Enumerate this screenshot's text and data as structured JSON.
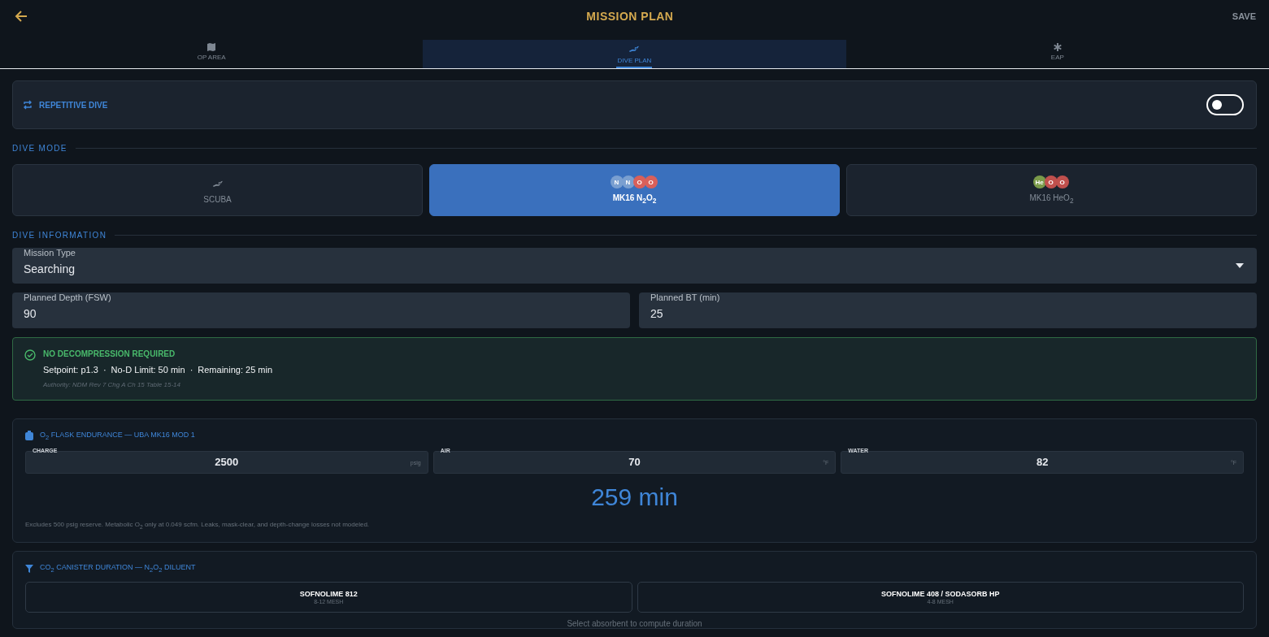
{
  "header": {
    "title": "MISSION PLAN",
    "action": "SAVE"
  },
  "tabs": [
    {
      "label": "OP AREA",
      "kind": "map",
      "selected": false
    },
    {
      "label": "DIVE PLAN",
      "kind": "diver",
      "selected": true
    },
    {
      "label": "EAP",
      "kind": "asterisk",
      "selected": false
    }
  ],
  "repetitive_dive": {
    "label": "REPETITIVE DIVE",
    "on": false
  },
  "dive_mode": {
    "heading": "DIVE MODE",
    "modes": [
      {
        "label": "SCUBA",
        "kind": "diver",
        "selected": false
      },
      {
        "label": "MK16 N$_{2}$O$_{2}$",
        "kind": "gas",
        "selected": true,
        "atoms": [
          {
            "symbol": "N",
            "color": "#7a9fd0"
          },
          {
            "symbol": "N",
            "color": "#7a9fd0"
          },
          {
            "symbol": "O",
            "color": "#d9605a"
          },
          {
            "symbol": "O",
            "color": "#d9605a"
          }
        ]
      },
      {
        "label": "MK16 HeO$_{2}$",
        "kind": "gas",
        "selected": false,
        "atoms": [
          {
            "symbol": "He",
            "color": "#7a9a4a"
          },
          {
            "symbol": "O",
            "color": "#c0504d"
          },
          {
            "symbol": "O",
            "color": "#c0504d"
          }
        ]
      }
    ]
  },
  "dive_information": {
    "heading": "DIVE INFORMATION",
    "mission_type": {
      "label": "Mission Type",
      "value": "Searching"
    },
    "planned_depth": {
      "label": "Planned Depth (FSW)",
      "value": "90"
    },
    "planned_bt": {
      "label": "Planned BT (min)",
      "value": "25"
    }
  },
  "status": {
    "title": "NO DECOMPRESSION REQUIRED",
    "details": [
      "Setpoint: p1.3",
      "No-D Limit: 50 min",
      "Remaining: 25 min"
    ],
    "separators": [
      "·",
      "·"
    ],
    "authority": "Authority: NDM Rev 7 Chg A Ch 15 Table 15-14"
  },
  "o2_flask": {
    "title": "O$_{2}$ FLASK ENDURANCE — UBA MK16 MOD 1",
    "fields": [
      {
        "label": "CHARGE",
        "value": "2500",
        "unit": "psig"
      },
      {
        "label": "AIR",
        "value": "70",
        "unit": "°F"
      },
      {
        "label": "WATER",
        "value": "82",
        "unit": "°F"
      }
    ],
    "result": "259 min",
    "note": "Excludes 500 psig reserve. Metabolic O$_{2}$ only at 0.049 scfm. Leaks, mask-clear, and depth-change losses not modeled."
  },
  "co2_canister": {
    "title": "CO$_{2}$ CANISTER DURATION — N$_{2}$O$_{2}$ DILUENT",
    "absorbents": [
      {
        "name": "SOFNOLIME 812",
        "mesh": "8-12 MESH",
        "selected": false
      },
      {
        "name": "SOFNOLIME 408 / SODASORB HP",
        "mesh": "4-8 MESH",
        "selected": false
      }
    ],
    "hint": "Select absorbent to compute duration"
  }
}
